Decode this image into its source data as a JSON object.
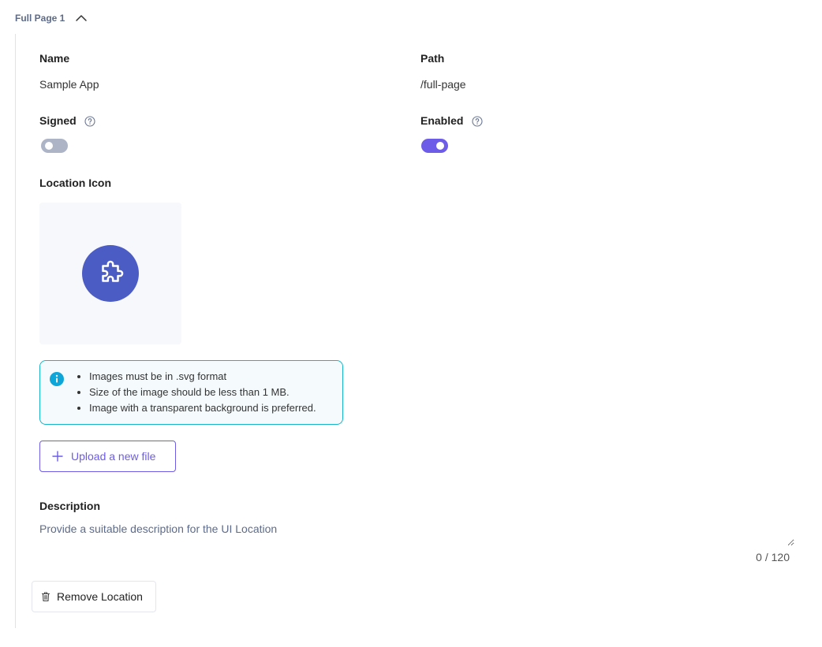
{
  "section": {
    "title": "Full Page 1",
    "expanded": true
  },
  "fields": {
    "name": {
      "label": "Name",
      "value": "Sample App"
    },
    "path": {
      "label": "Path",
      "value": "/full-page"
    },
    "signed": {
      "label": "Signed",
      "enabled": false
    },
    "enabled": {
      "label": "Enabled",
      "enabled": true
    }
  },
  "location_icon": {
    "label": "Location Icon",
    "icon": "puzzle-icon",
    "background_color": "#4c5cc5"
  },
  "info": {
    "items": [
      "Images must be in .svg format",
      "Size of the image should be less than 1 MB.",
      "Image with a transparent background is preferred."
    ]
  },
  "upload_button": {
    "label": "Upload a new file"
  },
  "description": {
    "label": "Description",
    "placeholder": "Provide a suitable description for the UI Location",
    "value": "",
    "counter": "0 / 120"
  },
  "remove_button": {
    "label": "Remove Location"
  },
  "colors": {
    "accent": "#6c5ce7",
    "toggle_off": "#acb4c6",
    "info_border": "#17b5c9",
    "header_text": "#5d6b8a"
  }
}
